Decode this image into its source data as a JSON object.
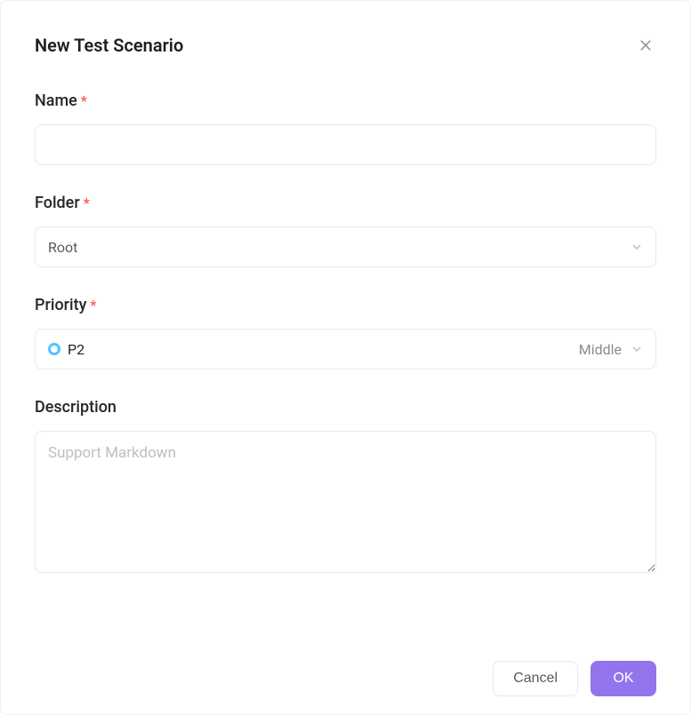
{
  "dialog": {
    "title": "New Test Scenario"
  },
  "form": {
    "name": {
      "label": "Name",
      "value": ""
    },
    "folder": {
      "label": "Folder",
      "selected": "Root"
    },
    "priority": {
      "label": "Priority",
      "selected_code": "P2",
      "selected_text": "Middle"
    },
    "description": {
      "label": "Description",
      "placeholder": "Support Markdown",
      "value": ""
    }
  },
  "buttons": {
    "cancel": "Cancel",
    "ok": "OK"
  }
}
